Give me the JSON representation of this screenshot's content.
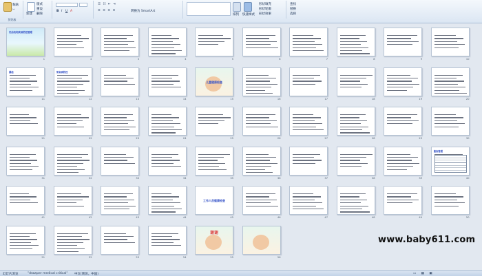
{
  "ribbon": {
    "clipboard": {
      "paste": "粘贴",
      "caption": "剪贴板"
    },
    "slides": {
      "new_slide": "新建",
      "layout": "版式",
      "reset": "重设",
      "delete": "删除",
      "caption": "幻灯片"
    },
    "paragraph": {
      "convert": "转换为 SmartArt"
    },
    "drawing": {
      "arrange": "排列",
      "quick_styles": "快速样式",
      "fill": "形状填充",
      "outline": "形状轮廓",
      "effects": "形状效果",
      "caption": "绘图"
    },
    "editing": {
      "find": "查找",
      "replace": "替换",
      "select": "选择",
      "caption": "编辑"
    }
  },
  "slides": [
    {
      "n": "1",
      "t": "托幼机构疾病防控管理"
    },
    {
      "n": "2",
      "t": ""
    },
    {
      "n": "3",
      "t": ""
    },
    {
      "n": "4",
      "t": ""
    },
    {
      "n": "5",
      "t": ""
    },
    {
      "n": "6",
      "t": ""
    },
    {
      "n": "7",
      "t": ""
    },
    {
      "n": "8",
      "t": ""
    },
    {
      "n": "9",
      "t": ""
    },
    {
      "n": "10",
      "t": ""
    },
    {
      "n": "11",
      "t": "晨检"
    },
    {
      "n": "12",
      "t": "传染病防控"
    },
    {
      "n": "13",
      "t": ""
    },
    {
      "n": "14",
      "t": ""
    },
    {
      "n": "15",
      "t": "儿童健康检查"
    },
    {
      "n": "16",
      "t": ""
    },
    {
      "n": "17",
      "t": ""
    },
    {
      "n": "18",
      "t": ""
    },
    {
      "n": "19",
      "t": ""
    },
    {
      "n": "20",
      "t": ""
    },
    {
      "n": "21",
      "t": ""
    },
    {
      "n": "22",
      "t": ""
    },
    {
      "n": "23",
      "t": ""
    },
    {
      "n": "24",
      "t": ""
    },
    {
      "n": "25",
      "t": ""
    },
    {
      "n": "26",
      "t": ""
    },
    {
      "n": "27",
      "t": ""
    },
    {
      "n": "28",
      "t": ""
    },
    {
      "n": "29",
      "t": ""
    },
    {
      "n": "30",
      "t": ""
    },
    {
      "n": "31",
      "t": ""
    },
    {
      "n": "32",
      "t": ""
    },
    {
      "n": "33",
      "t": ""
    },
    {
      "n": "34",
      "t": ""
    },
    {
      "n": "35",
      "t": ""
    },
    {
      "n": "36",
      "t": ""
    },
    {
      "n": "37",
      "t": ""
    },
    {
      "n": "38",
      "t": ""
    },
    {
      "n": "39",
      "t": ""
    },
    {
      "n": "40",
      "t": "膳食管理"
    },
    {
      "n": "41",
      "t": ""
    },
    {
      "n": "42",
      "t": ""
    },
    {
      "n": "43",
      "t": ""
    },
    {
      "n": "44",
      "t": ""
    },
    {
      "n": "45",
      "t": "工作人员健康检查"
    },
    {
      "n": "46",
      "t": ""
    },
    {
      "n": "47",
      "t": ""
    },
    {
      "n": "48",
      "t": ""
    },
    {
      "n": "49",
      "t": ""
    },
    {
      "n": "50",
      "t": ""
    },
    {
      "n": "51",
      "t": ""
    },
    {
      "n": "52",
      "t": ""
    },
    {
      "n": "53",
      "t": ""
    },
    {
      "n": "54",
      "t": ""
    },
    {
      "n": "55",
      "t": "谢谢"
    },
    {
      "n": "56",
      "t": ""
    }
  ],
  "watermark": "www.baby611.com",
  "status": {
    "slide_sorter": "幻灯片浏览",
    "theme": "\"drawper medical critical\"",
    "language": "中文(简体，中国)"
  }
}
